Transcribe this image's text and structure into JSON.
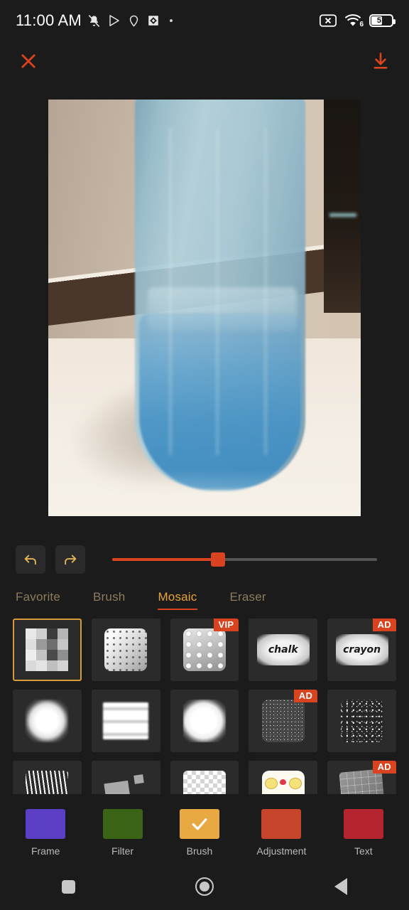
{
  "statusbar": {
    "time": "11:00 AM",
    "left_icons": [
      "mute-vibrate-icon",
      "play-store-icon",
      "location-pin-icon",
      "google-maps-icon",
      "overflow-dot-icon"
    ],
    "right_icons": [
      "no-sim-icon",
      "wifi-icon",
      "battery-icon"
    ],
    "wifi_generation": "6",
    "battery_percent": "51"
  },
  "topbar": {
    "close_label": "close-icon",
    "save_label": "download-icon",
    "accent_color": "#d9431f"
  },
  "photo": {
    "description": "blue translucent plastic bottle on cream surface against beige wall"
  },
  "editor": {
    "undo_label": "undo-icon",
    "redo_label": "redo-icon",
    "slider": {
      "name": "brush-size-slider",
      "value_percent": 40,
      "fill_color": "#d9431f",
      "track_color": "#555555"
    }
  },
  "tabs": [
    {
      "label": "Favorite",
      "active": false
    },
    {
      "label": "Brush",
      "active": false
    },
    {
      "label": "Mosaic",
      "active": true
    },
    {
      "label": "Eraser",
      "active": false
    }
  ],
  "brushes": [
    {
      "name": "mosaic-pixel",
      "type": "mosaic",
      "badge": "",
      "selected": true,
      "label": ""
    },
    {
      "name": "mosaic-dots",
      "type": "dots",
      "badge": "",
      "selected": false,
      "label": ""
    },
    {
      "name": "mosaic-lego",
      "type": "lego",
      "badge": "VIP",
      "selected": false,
      "label": ""
    },
    {
      "name": "brush-chalk",
      "type": "chalk",
      "badge": "",
      "selected": false,
      "label": "chalk"
    },
    {
      "name": "brush-crayon",
      "type": "chalk",
      "badge": "AD",
      "selected": false,
      "label": "crayon"
    },
    {
      "name": "brush-cloud",
      "type": "cloud",
      "badge": "",
      "selected": false,
      "label": ""
    },
    {
      "name": "brush-stripes",
      "type": "stripes",
      "badge": "",
      "selected": false,
      "label": ""
    },
    {
      "name": "brush-splat",
      "type": "splat",
      "badge": "",
      "selected": false,
      "label": ""
    },
    {
      "name": "brush-grain",
      "type": "grain",
      "badge": "AD",
      "selected": false,
      "label": ""
    },
    {
      "name": "brush-rough",
      "type": "rough",
      "badge": "",
      "selected": false,
      "label": ""
    },
    {
      "name": "brush-hatch",
      "type": "hatch",
      "badge": "",
      "selected": false,
      "label": ""
    },
    {
      "name": "brush-shapes",
      "type": "shapes",
      "badge": "",
      "selected": false,
      "label": ""
    },
    {
      "name": "brush-checker",
      "type": "checker",
      "badge": "",
      "selected": false,
      "label": ""
    },
    {
      "name": "brush-emoji",
      "type": "emoji",
      "badge": "",
      "selected": false,
      "label": ""
    },
    {
      "name": "brush-stamp",
      "type": "stamp",
      "badge": "AD",
      "selected": false,
      "label": ""
    }
  ],
  "toolbar": [
    {
      "label": "Frame",
      "color": "#5b3fc4",
      "active": false
    },
    {
      "label": "Filter",
      "color": "#3a6315",
      "active": false
    },
    {
      "label": "Brush",
      "color": "#e9a942",
      "active": true
    },
    {
      "label": "Adjustment",
      "color": "#c5442a",
      "active": false
    },
    {
      "label": "Text",
      "color": "#b5252f",
      "active": false
    }
  ],
  "navbar": [
    {
      "name": "recents-button",
      "icon": "square-icon"
    },
    {
      "name": "home-button",
      "icon": "circle-icon"
    },
    {
      "name": "back-button",
      "icon": "triangle-left-icon"
    }
  ]
}
